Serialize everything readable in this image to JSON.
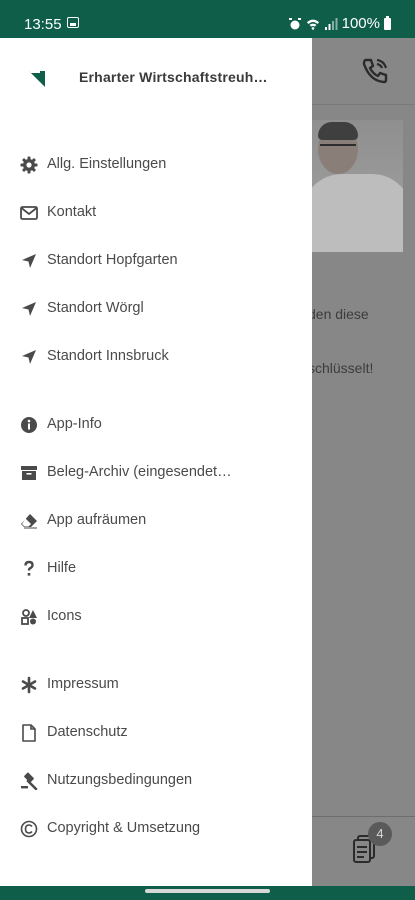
{
  "status_bar": {
    "time": "13:55",
    "battery": "100%"
  },
  "drawer": {
    "title": "Erharter Wirtschaftstreuh…",
    "items": [
      {
        "label": "Allg. Einstellungen",
        "icon": "gear-icon"
      },
      {
        "label": "Kontakt",
        "icon": "mail-icon"
      },
      {
        "label": "Standort Hopfgarten",
        "icon": "location-arrow-icon"
      },
      {
        "label": "Standort Wörgl",
        "icon": "location-arrow-icon"
      },
      {
        "label": "Standort Innsbruck",
        "icon": "location-arrow-icon"
      },
      {
        "label": "App-Info",
        "icon": "info-icon"
      },
      {
        "label": "Beleg-Archiv (eingesendet…",
        "icon": "archive-icon"
      },
      {
        "label": "App aufräumen",
        "icon": "eraser-icon"
      },
      {
        "label": "Hilfe",
        "icon": "question-icon"
      },
      {
        "label": "Icons",
        "icon": "icons-icon"
      },
      {
        "label": "Impressum",
        "icon": "asterisk-icon"
      },
      {
        "label": "Datenschutz",
        "icon": "file-icon"
      },
      {
        "label": "Nutzungsbedingungen",
        "icon": "gavel-icon"
      },
      {
        "label": "Copyright & Umsetzung",
        "icon": "copyright-icon"
      }
    ]
  },
  "background": {
    "text_line_1": "den diese",
    "text_line_2": "schlüsselt!",
    "badge_count": "4"
  },
  "colors": {
    "brand": "#0f5e49",
    "scrim": "#878787"
  }
}
